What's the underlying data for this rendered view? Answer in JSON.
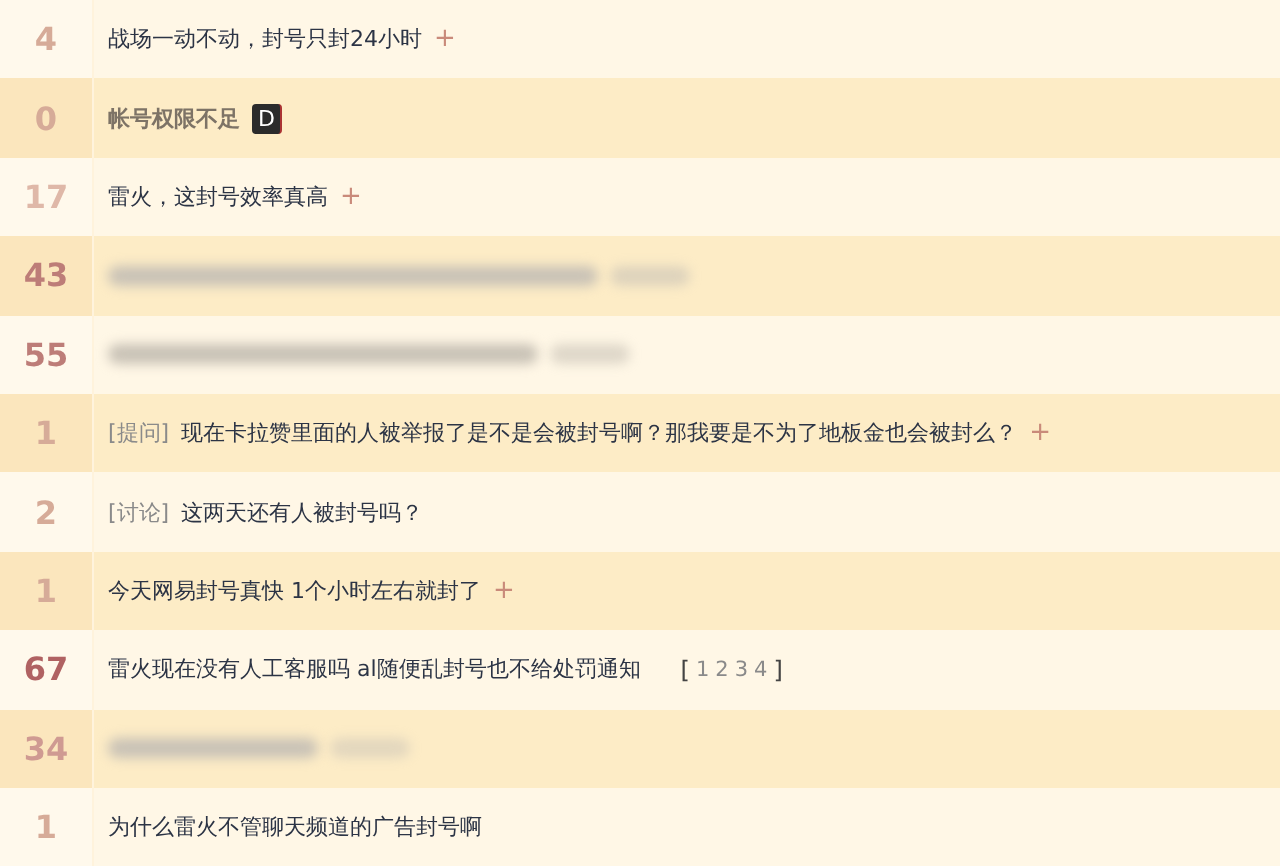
{
  "threads": [
    {
      "count": "4",
      "color": "#d6ab98",
      "kind": "text",
      "title": "战场一动不动，封号只封24小时",
      "restricted": false,
      "plus": "+"
    },
    {
      "count": "0",
      "color": "#d6ab98",
      "kind": "text",
      "title": "帐号权限不足",
      "restricted": true,
      "badge": "D"
    },
    {
      "count": "17",
      "color": "#dfb8a8",
      "kind": "text",
      "title": "雷火，这封号效率真高",
      "restricted": false,
      "plus": "+"
    },
    {
      "count": "43",
      "color": "#bd7d78",
      "kind": "blurred"
    },
    {
      "count": "55",
      "color": "#bd7d78",
      "kind": "blurred"
    },
    {
      "count": "1",
      "color": "#d6ab98",
      "kind": "text",
      "tag": "[提问]",
      "title": "现在卡拉赞里面的人被举报了是不是会被封号啊？那我要是不为了地板金也会被封么？",
      "restricted": false,
      "plus": "+"
    },
    {
      "count": "2",
      "color": "#d6ab98",
      "kind": "text",
      "tag": "[讨论]",
      "title": "这两天还有人被封号吗？",
      "restricted": false
    },
    {
      "count": "1",
      "color": "#d6ab98",
      "kind": "text",
      "title": "今天网易封号真快 1个小时左右就封了",
      "restricted": false,
      "plus": "+"
    },
    {
      "count": "67",
      "color": "#b06262",
      "kind": "text",
      "title": "雷火现在没有人工客服吗 al随便乱封号也不给处罚通知",
      "restricted": false,
      "pages": {
        "open": "[",
        "numbers": [
          "1",
          "2",
          "3",
          "4"
        ],
        "close": "]"
      }
    },
    {
      "count": "34",
      "color": "#cf9a92",
      "kind": "blurred_short"
    },
    {
      "count": "1",
      "color": "#d6ab98",
      "kind": "text",
      "title": "为什么雷火不管聊天频道的广告封号啊",
      "restricted": false
    }
  ]
}
